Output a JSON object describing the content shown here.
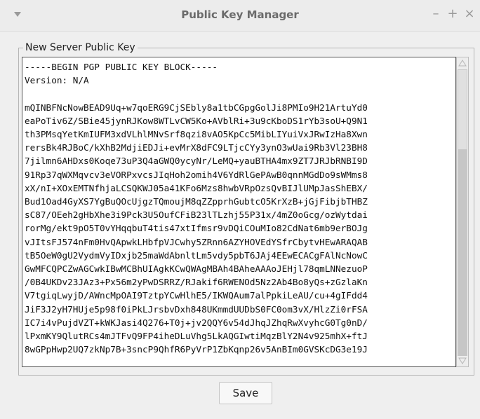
{
  "window": {
    "title": "Public Key Manager",
    "controls": {
      "minimize": "–",
      "maximize": "+",
      "close": "×"
    }
  },
  "group": {
    "legend": "New Server Public Key"
  },
  "key_text": "-----BEGIN PGP PUBLIC KEY BLOCK-----\nVersion: N/A\n\nmQINBFNcNowBEAD9Uq+w7qoERG9CjSEbly8a1tbCGpgGolJi8PMIo9H21ArtuYd0\neaPoTiv6Z/SBie45jynRJKow8WTLvCW5Ko+AVblRi+3u9cKboDS1rYb3soU+Q9N1\nth3PMsqYetKmIUFM3xdVLhlMNvSrf8qzi8vAO5KpCc5MibLIYuiVxJRwIzHa8Xwn\nrersBk4RJBoC/kXhB2MdjiEDJi+evMrX8dFC9LTjcCYy3ynO3wUai9Rb3Vl23BH8\n7jilmn6AHDxs0Koqe73uP3Q4aGWQ0ycyNr/LeMQ+yauBTHA4mx9ZT7JRJbRNBI9D\n91Rp37qWXMqvcv3eVORPxvcsJIqHoh2omih4V6YdRlGePAwB0qnnMGdDo9sWMms8\nxX/nI+XOxEMTNfhjaLCSQKWJ05a41KFo6Mzs8hwbVRpOzsQvBIJlUMpJasShEBX/\nBud1Oad4GyXS7YgBuQOcUjgzTQmoujM8qZZpprhGubtcO5KrXzB+jGjFibjbTHBZ\nsC87/OEeh2gHbXhe3i9Pck3U5OufCFiB23lTLzhj55P31x/4mZ0oGcg/ozWytdai\nrorMg/ekt9pO5T0vYHqqbuT4tis47xtIfmsr9vDQiCOuMIo82CdNat6mb9erBOJg\nvJItsFJ574nFm0HvQApwkLHbfpVJCwhy5ZRnn6AZYHOVEdYSfrCbytvHEwARAQAB\ntB5OeW0gU2VydmVyIDxjb25maWdAbnltLm5vdy5pbT6JAj4EEwECACgFAlNcNowC\nGwMFCQPCZwAGCwkIBwMCBhUIAgkKCwQWAgMBAh4BAheAAAoJEHjl78qmLNNezuoP\n/0B4UKDv23JAz3+Px56m2yPwDSRRZ/RJakif6RWENOd5Nz2Ab4Bo8yQs+zGzlaKn\nV7tgiqLwyjD/AWncMpOAI9TztpYCwHlhE5/IKWQAum7alPpkiLeAU/cu+4gIFdd4\nJiF3J2yH7HUje5p98f0iPkLJrsbvDxh848UKmmdUUDbS0FC0om3vX/HlzZi0rFSA\nIC7i4vPujdVZT+kWKJasi4Q276+T0j+jv2QQY6v54dJhqJZhqRwXvyhcG0Tg0nD/\nlPxmKY9QlutRCs4mJTFvQ9FP4iheDLuVhg5LkAQGIwtiMqzBlY2N4v925mhX+ftJ\n8wGPpHwp2UQ7zkNp7B+3sncP9QhfR6PyVrP1ZbKqnp26v5AnBIm0GVSKcDG3e19J",
  "scrollbar": {
    "thumb_start_fraction": 0.0,
    "thumb_end_fraction": 0.28
  },
  "buttons": {
    "save_label": "Save"
  }
}
